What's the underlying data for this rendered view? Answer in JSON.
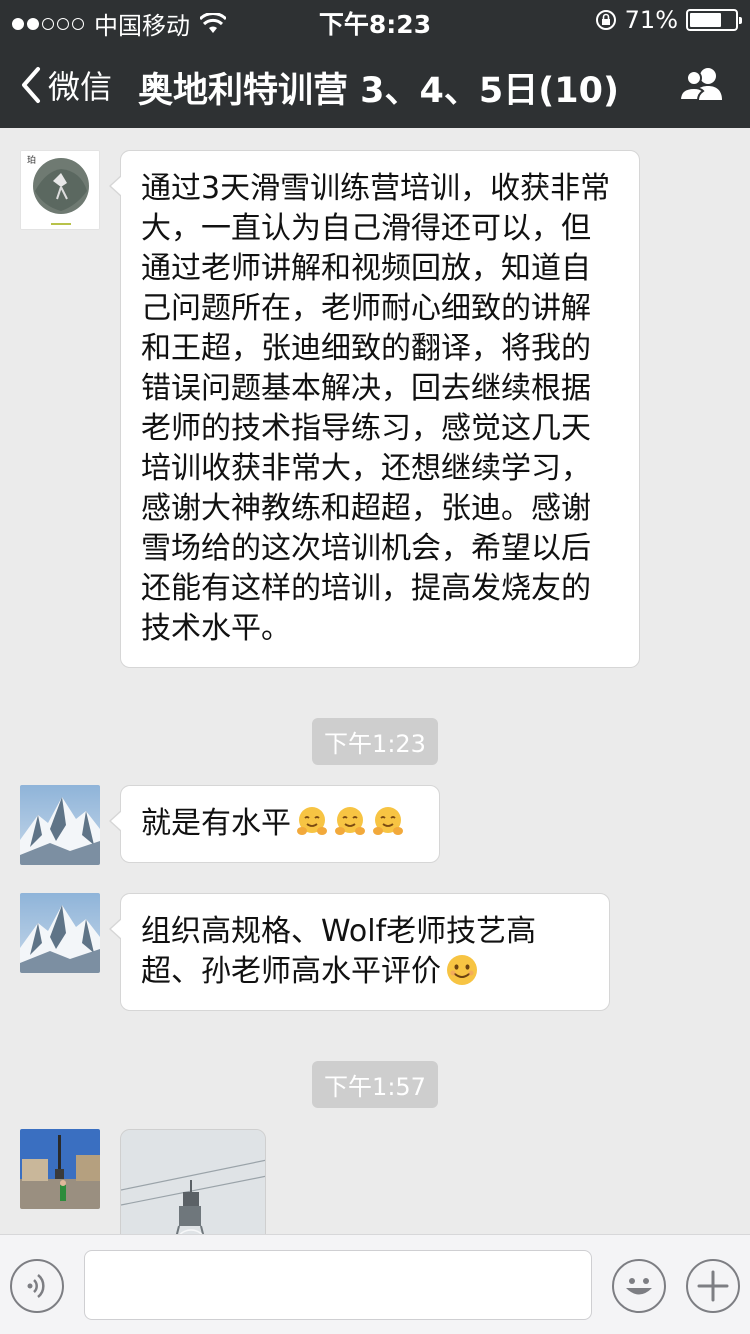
{
  "status_bar": {
    "carrier": "中国移动",
    "time": "下午8:23",
    "battery_text": "71%",
    "battery_level": 0.71,
    "signal_dots_filled": 2,
    "signal_dots_total": 5
  },
  "nav": {
    "back_label": "微信",
    "title": "奥地利特训营 3、4、5日(10)",
    "back_icon": "chevron-left-icon",
    "group_icon": "group-members-icon"
  },
  "messages": [
    {
      "type": "text",
      "text": "通过3天滑雪训练营培训，收获非常大，一直认为自己滑得还可以，但通过老师讲解和视频回放，知道自己问题所在，老师耐心细致的讲解和王超，张迪细致的翻译，将我的错误问题基本解决，回去继续根据老师的技术指导练习，感觉这几天培训收获非常大，还想继续学习，感谢大神教练和超超，张迪。感谢雪场给的这次培训机会，希望以后还能有这样的培训，提高发烧友的技术水平。"
    },
    {
      "type": "timestamp",
      "text": "下午1:23"
    },
    {
      "type": "text",
      "text": "就是有水平",
      "emoji_count": 3,
      "emoji_icon": "hugging-face-icon"
    },
    {
      "type": "text",
      "text": "组织高规格、Wolf老师技艺高超、孙老师高水平评价",
      "emoji_icon": "smiling-face-icon"
    },
    {
      "type": "timestamp",
      "text": "下午1:57"
    },
    {
      "type": "image",
      "image_icon": "ski-lift-photo"
    }
  ],
  "input_bar": {
    "value": "",
    "voice_icon": "voice-icon",
    "emoji_icon": "emoji-icon",
    "plus_icon": "plus-icon"
  }
}
